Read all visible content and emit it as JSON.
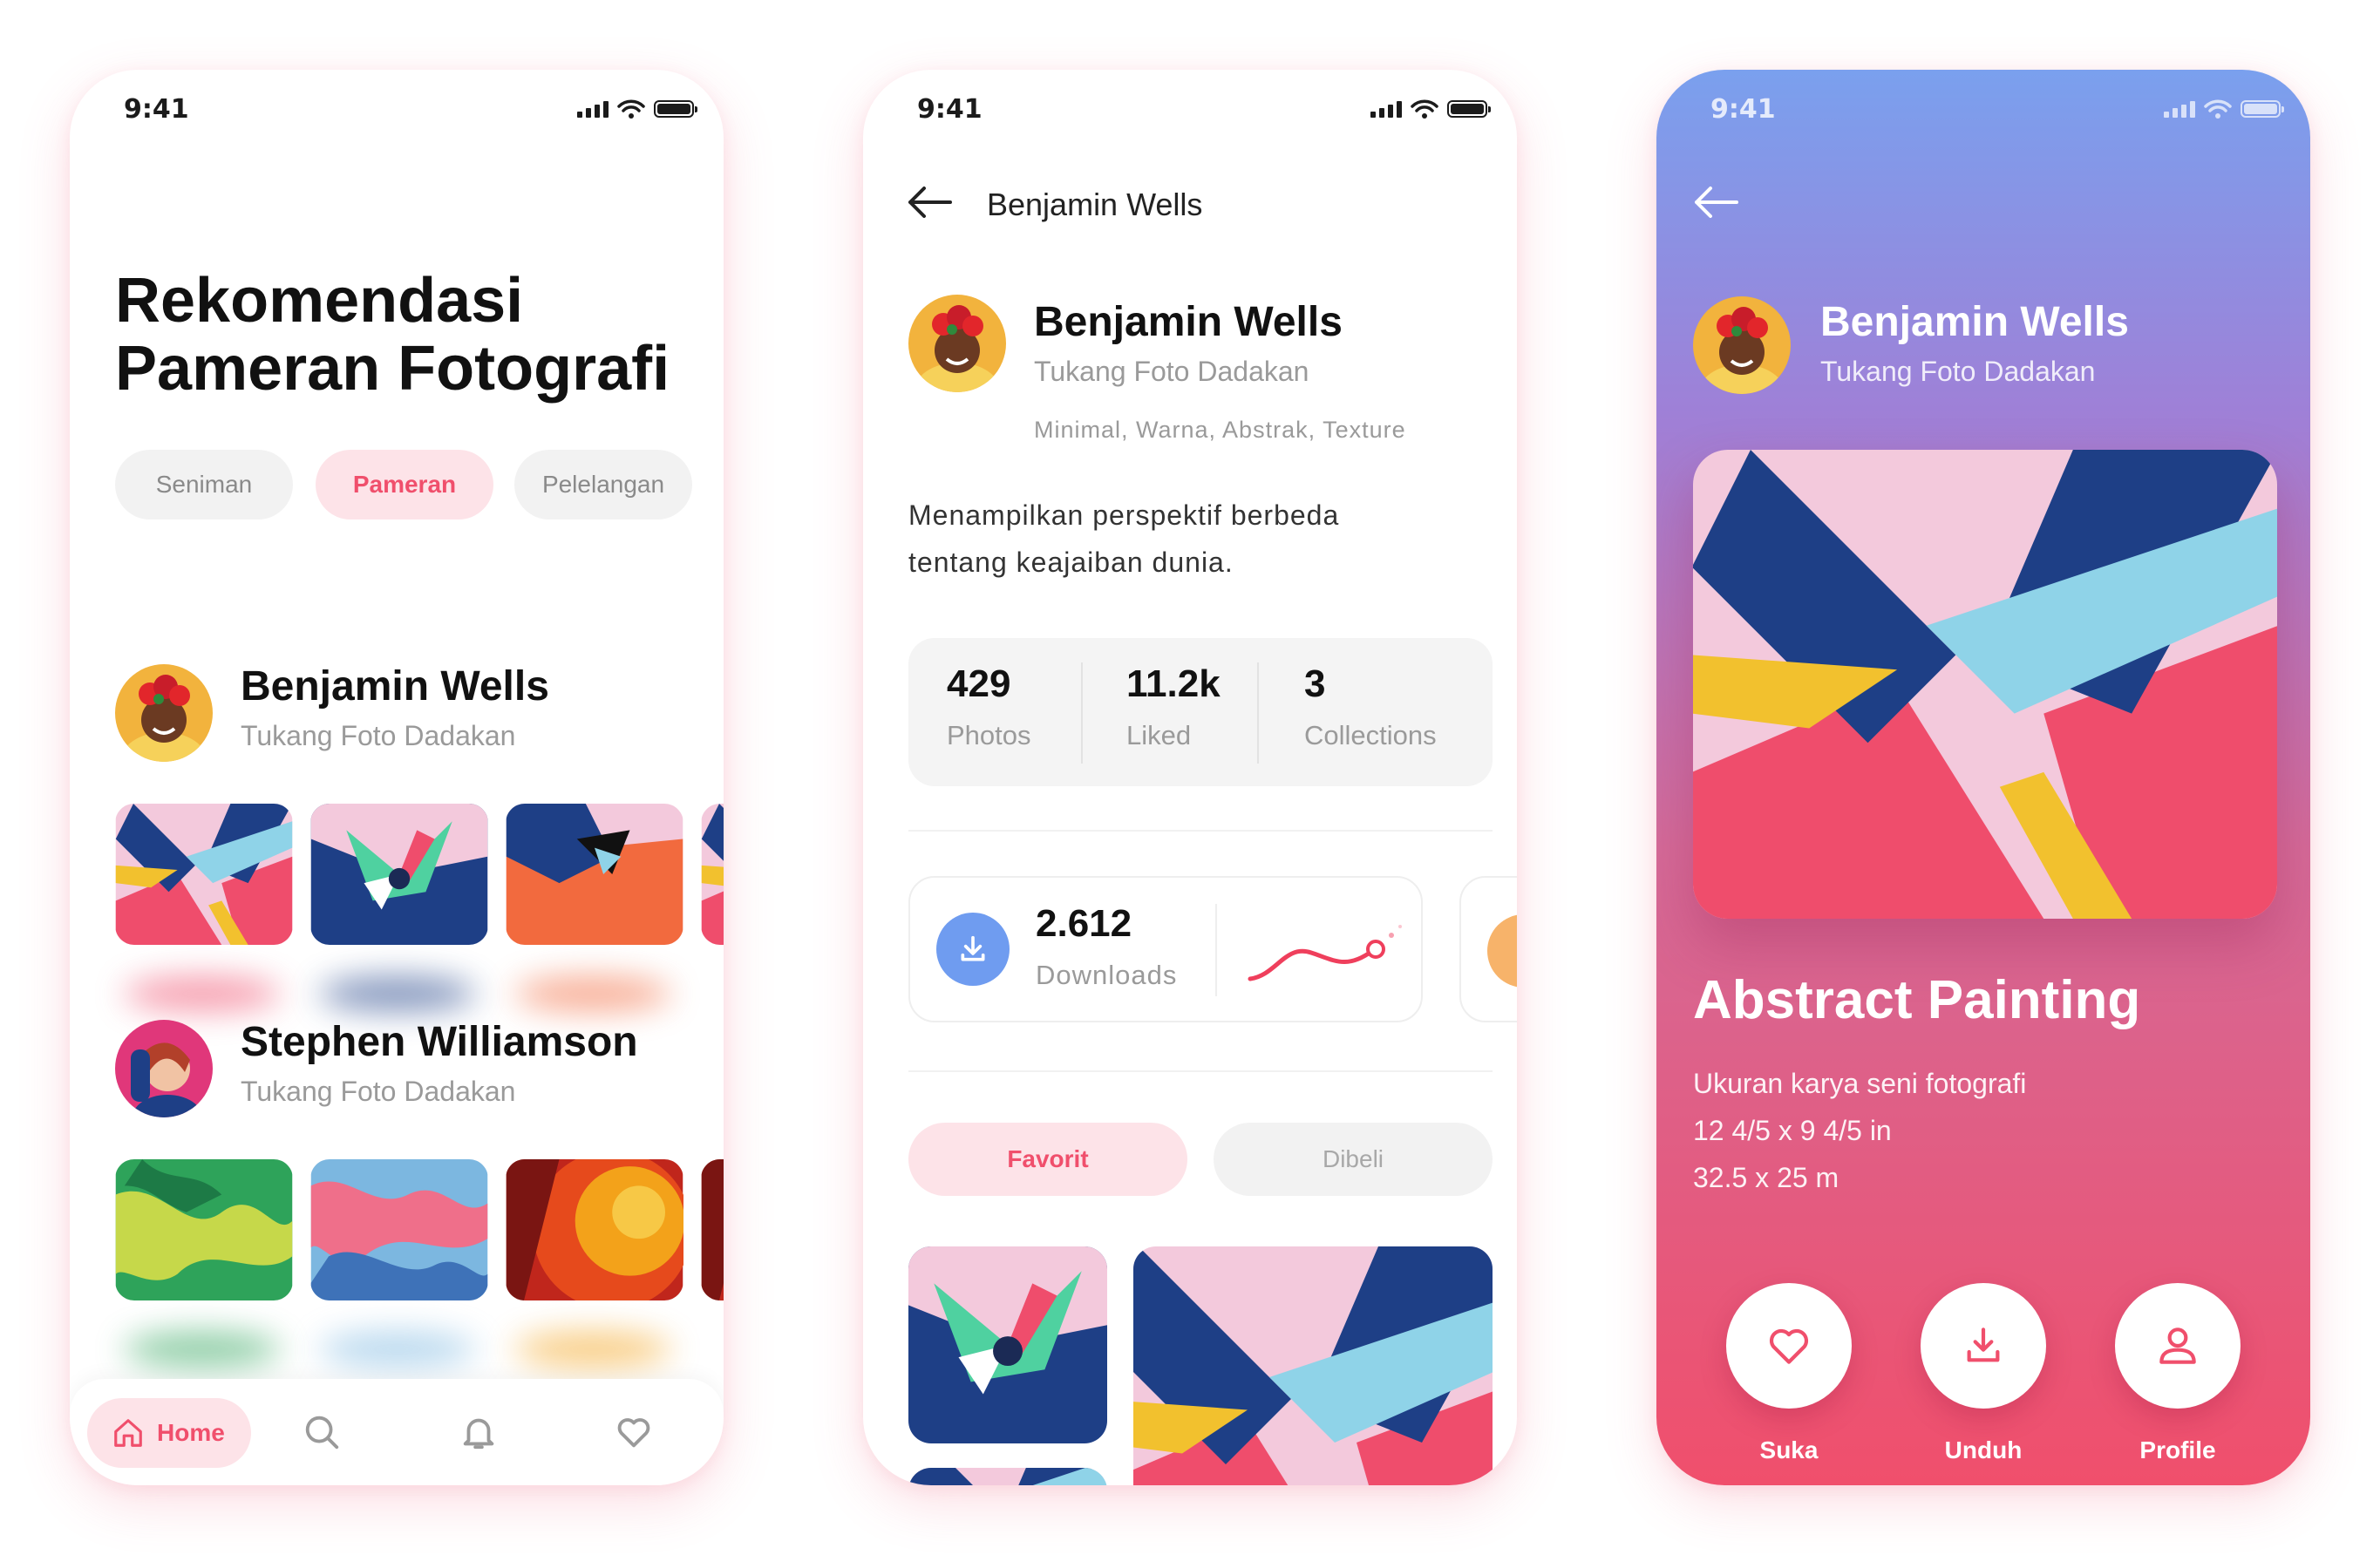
{
  "status": {
    "time": "9:41"
  },
  "screen1": {
    "title_line1": "Rekomendasi",
    "title_line2": "Pameran Fotografi",
    "filters": [
      {
        "label": "Seniman",
        "active": false
      },
      {
        "label": "Pameran",
        "active": true
      },
      {
        "label": "Pelelangan",
        "active": false
      }
    ],
    "photographers": [
      {
        "name": "Benjamin Wells",
        "role": "Tukang Foto Dadakan"
      },
      {
        "name": "Stephen Williamson",
        "role": "Tukang Foto Dadakan"
      }
    ],
    "tabbar": {
      "home_label": "Home",
      "items": [
        "home-icon",
        "search-icon",
        "bell-icon",
        "heart-icon"
      ]
    }
  },
  "screen2": {
    "nav_title": "Benjamin Wells",
    "name": "Benjamin Wells",
    "role": "Tukang Foto Dadakan",
    "tags": "Minimal, Warna, Abstrak, Texture",
    "description_line1": "Menampilkan perspektif berbeda",
    "description_line2": "tentang keajaiban dunia.",
    "stats": [
      {
        "value": "429",
        "label": "Photos"
      },
      {
        "value": "11.2k",
        "label": "Liked"
      },
      {
        "value": "3",
        "label": "Collections"
      }
    ],
    "downloads": {
      "value": "2.612",
      "label": "Downloads"
    },
    "segments": [
      {
        "label": "Favorit",
        "active": true
      },
      {
        "label": "Dibeli",
        "active": false
      }
    ]
  },
  "screen3": {
    "name": "Benjamin Wells",
    "role": "Tukang Foto Dadakan",
    "art_title": "Abstract Painting",
    "meta_line1": "Ukuran karya seni fotografi",
    "meta_line2": "12 4/5 x 9 4/5 in",
    "meta_line3": "32.5 x 25 m",
    "actions": [
      {
        "label": "Suka",
        "icon": "heart-icon"
      },
      {
        "label": "Unduh",
        "icon": "download-icon"
      },
      {
        "label": "Profile",
        "icon": "user-icon"
      }
    ]
  },
  "colors": {
    "accent": "#f04f6c",
    "accent_soft": "#fde3e8",
    "gradient_top": "#7aa0ee",
    "gradient_bottom": "#f04f6c"
  }
}
